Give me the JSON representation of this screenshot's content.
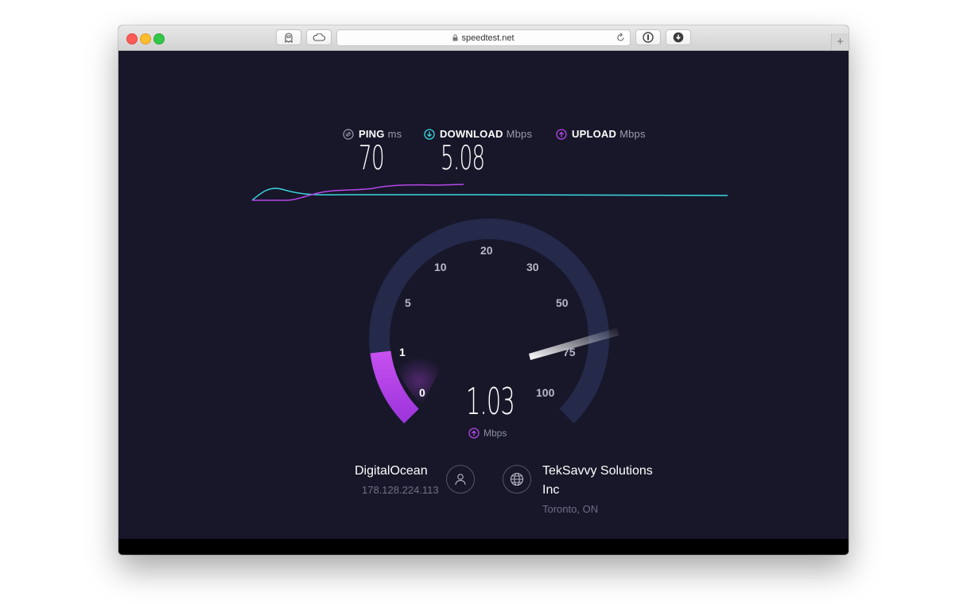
{
  "browser": {
    "url": "speedtest.net",
    "new_tab_label": "+"
  },
  "metrics": {
    "ping": {
      "label": "PING",
      "unit": "ms",
      "value": "70"
    },
    "download": {
      "label": "DOWNLOAD",
      "unit": "Mbps",
      "value": "5.08"
    },
    "upload": {
      "label": "UPLOAD",
      "unit": "Mbps"
    }
  },
  "gauge": {
    "ticks": [
      "0",
      "1",
      "5",
      "10",
      "20",
      "30",
      "50",
      "75",
      "100"
    ],
    "current_value": "1.03",
    "current_unit": "Mbps"
  },
  "server": {
    "name": "DigitalOcean",
    "ip": "178.128.224.113"
  },
  "isp": {
    "name_line1": "TekSavvy Solutions",
    "name_line2": "Inc",
    "location": "Toronto, ON"
  },
  "colors": {
    "download": "#3ad9e0",
    "upload": "#b647e8",
    "background": "#171729",
    "gauge_track": "#25294a"
  }
}
